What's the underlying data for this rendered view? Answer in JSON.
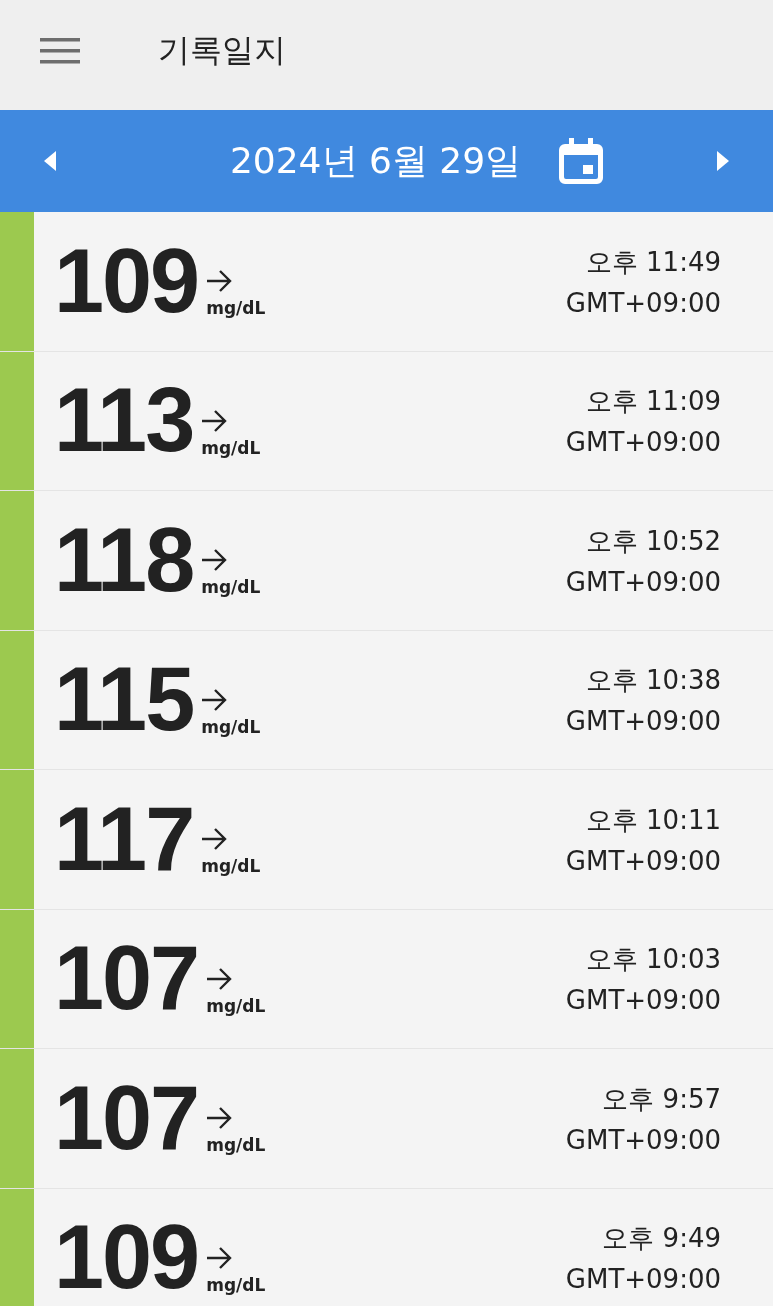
{
  "app_bar": {
    "title": "기록일지"
  },
  "date_bar": {
    "date": "2024년 6월 29일"
  },
  "readings": [
    {
      "value": "109",
      "unit": "mg/dL",
      "time": "오후 11:49",
      "timezone": "GMT+09:00",
      "color": "#9cc94f"
    },
    {
      "value": "113",
      "unit": "mg/dL",
      "time": "오후 11:09",
      "timezone": "GMT+09:00",
      "color": "#9cc94f"
    },
    {
      "value": "118",
      "unit": "mg/dL",
      "time": "오후 10:52",
      "timezone": "GMT+09:00",
      "color": "#9cc94f"
    },
    {
      "value": "115",
      "unit": "mg/dL",
      "time": "오후 10:38",
      "timezone": "GMT+09:00",
      "color": "#9cc94f"
    },
    {
      "value": "117",
      "unit": "mg/dL",
      "time": "오후 10:11",
      "timezone": "GMT+09:00",
      "color": "#9cc94f"
    },
    {
      "value": "107",
      "unit": "mg/dL",
      "time": "오후 10:03",
      "timezone": "GMT+09:00",
      "color": "#9cc94f"
    },
    {
      "value": "107",
      "unit": "mg/dL",
      "time": "오후 9:57",
      "timezone": "GMT+09:00",
      "color": "#9cc94f"
    },
    {
      "value": "109",
      "unit": "mg/dL",
      "time": "오후 9:49",
      "timezone": "GMT+09:00",
      "color": "#9cc94f"
    }
  ]
}
